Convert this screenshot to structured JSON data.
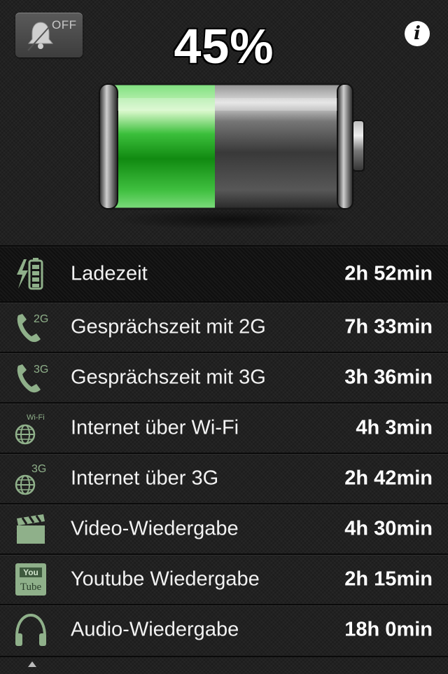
{
  "header": {
    "alarm_toggle_label": "OFF",
    "battery_percent_text": "45%",
    "info_label": "i"
  },
  "battery": {
    "level": 0.45,
    "fill_color": "#2fb52f"
  },
  "rows": [
    {
      "icon": "charging-battery-icon",
      "label": "Ladezeit",
      "value": "2h 52min"
    },
    {
      "icon": "phone-2g-icon",
      "label": "Gesprächszeit mit 2G",
      "value": "7h 33min"
    },
    {
      "icon": "phone-3g-icon",
      "label": "Gesprächszeit mit 3G",
      "value": "3h 36min"
    },
    {
      "icon": "globe-wifi-icon",
      "label": "Internet über Wi-Fi",
      "value": "4h 3min"
    },
    {
      "icon": "globe-3g-icon",
      "label": "Internet über 3G",
      "value": "2h 42min"
    },
    {
      "icon": "clapperboard-icon",
      "label": "Video-Wiedergabe",
      "value": "4h 30min"
    },
    {
      "icon": "youtube-icon",
      "label": "Youtube Wiedergabe",
      "value": "2h 15min"
    },
    {
      "icon": "headphones-icon",
      "label": "Audio-Wiedergabe",
      "value": "18h 0min"
    }
  ],
  "icon_texts": {
    "badge_2g": "2G",
    "badge_3g": "3G",
    "badge_wifi": "Wi-Fi",
    "yt_top": "You",
    "yt_bottom": "Tube"
  },
  "colors": {
    "icon_green": "#8fb08a",
    "row_text": "#f2f2f2"
  }
}
